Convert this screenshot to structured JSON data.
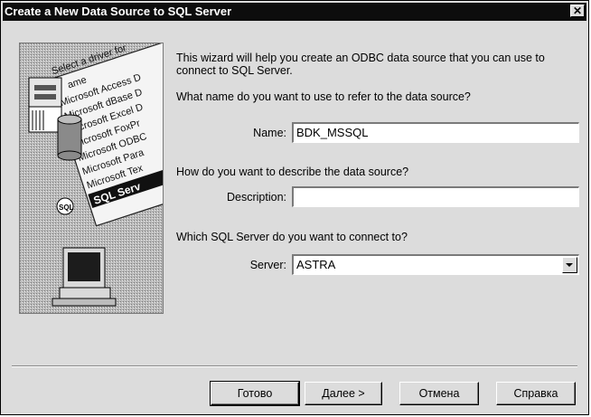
{
  "window": {
    "title": "Create a New Data Source to SQL Server",
    "close_glyph": "✕"
  },
  "illustration": {
    "caption": "Select a driver for",
    "drivers": [
      "ame",
      "Microsoft Access D",
      "Microsoft dBase D",
      "Microsoft Excel D",
      "Microsoft FoxPr",
      "Microsoft ODBC",
      "Microsoft Para",
      "Microsoft Tex",
      "SQL Serv"
    ]
  },
  "intro": {
    "line1": "This wizard will help you create an ODBC data source that you can use to",
    "line2": "connect to SQL Server."
  },
  "name_section": {
    "question": "What name do you want to use to refer to the data source?",
    "label": "Name:",
    "value": "BDK_MSSQL"
  },
  "description_section": {
    "question": "How do you want to describe the data source?",
    "label": "Description:",
    "value": ""
  },
  "server_section": {
    "question": "Which SQL Server do you want to connect to?",
    "label": "Server:",
    "value": "ASTRA"
  },
  "buttons": {
    "finish": "Готово",
    "next": "Далее >",
    "cancel": "Отмена",
    "help": "Справка"
  }
}
